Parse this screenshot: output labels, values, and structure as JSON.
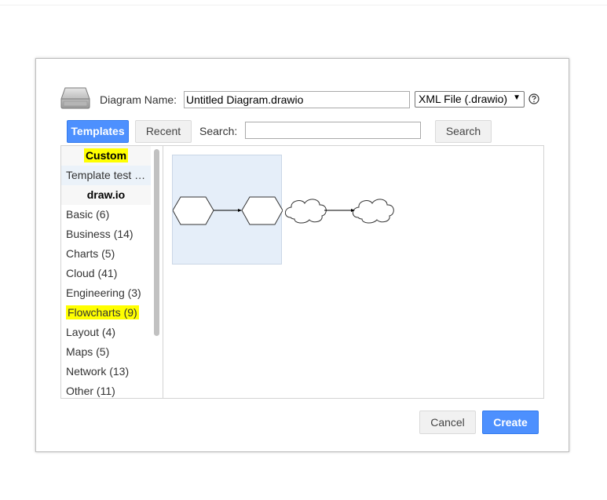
{
  "dialog": {
    "name_label": "Diagram Name:",
    "name_value": "Untitled Diagram.drawio",
    "format_value": "XML File (.drawio)",
    "help_icon": "help-circle-icon",
    "drive_icon": "hard-drive-icon"
  },
  "toolbar": {
    "templates_label": "Templates",
    "recent_label": "Recent",
    "search_label": "Search:",
    "search_value": "",
    "search_button_label": "Search"
  },
  "sidebar": {
    "items": [
      {
        "label": "Custom",
        "type": "header",
        "highlight": true
      },
      {
        "label": "Template test …",
        "type": "item",
        "selected": true
      },
      {
        "label": "draw.io",
        "type": "header"
      },
      {
        "label": "Basic (6)",
        "type": "item"
      },
      {
        "label": "Business (14)",
        "type": "item"
      },
      {
        "label": "Charts (5)",
        "type": "item"
      },
      {
        "label": "Cloud (41)",
        "type": "item"
      },
      {
        "label": "Engineering (3)",
        "type": "item"
      },
      {
        "label": "Flowcharts (9)",
        "type": "item",
        "highlight": true
      },
      {
        "label": "Layout (4)",
        "type": "item"
      },
      {
        "label": "Maps (5)",
        "type": "item"
      },
      {
        "label": "Network (13)",
        "type": "item"
      },
      {
        "label": "Other (11)",
        "type": "item"
      }
    ]
  },
  "templates": [
    {
      "shape": "hexagon-to-hexagon",
      "selected": true
    },
    {
      "shape": "cloud-to-cloud",
      "selected": false
    }
  ],
  "footer": {
    "cancel_label": "Cancel",
    "create_label": "Create"
  },
  "colors": {
    "primary": "#4d90fe",
    "highlight": "#ffff00",
    "selected_bg": "#e5eef9"
  }
}
